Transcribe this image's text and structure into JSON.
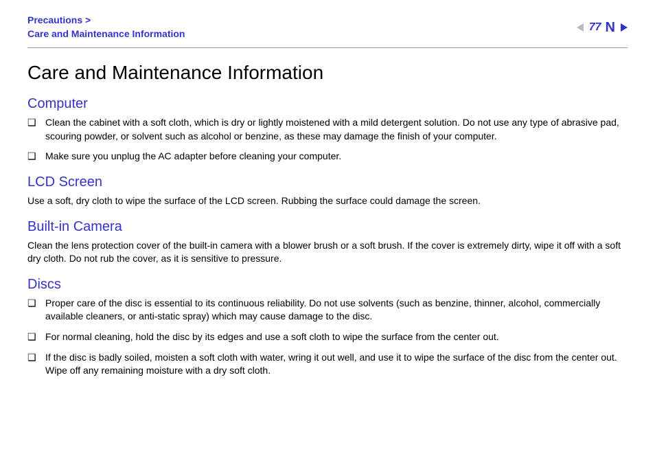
{
  "header": {
    "breadcrumb_parent": "Precautions >",
    "breadcrumb_current": "Care and Maintenance Information",
    "page_number": "77"
  },
  "title": "Care and Maintenance Information",
  "sections": {
    "computer": {
      "heading": "Computer",
      "items": [
        "Clean the cabinet with a soft cloth, which is dry or lightly moistened with a mild detergent solution. Do not use any type of abrasive pad, scouring powder, or solvent such as alcohol or benzine, as these may damage the finish of your computer.",
        "Make sure you unplug the AC adapter before cleaning your computer."
      ]
    },
    "lcd": {
      "heading": "LCD Screen",
      "text": "Use a soft, dry cloth to wipe the surface of the LCD screen. Rubbing the surface could damage the screen."
    },
    "camera": {
      "heading": "Built-in Camera",
      "text": "Clean the lens protection cover of the built-in camera with a blower brush or a soft brush. If the cover is extremely dirty, wipe it off with a soft dry cloth. Do not rub the cover, as it is sensitive to pressure."
    },
    "discs": {
      "heading": "Discs",
      "items": [
        "Proper care of the disc is essential to its continuous reliability. Do not use solvents (such as benzine, thinner, alcohol, commercially available cleaners, or anti-static spray) which may cause damage to the disc.",
        "For normal cleaning, hold the disc by its edges and use a soft cloth to wipe the surface from the center out.",
        "If the disc is badly soiled, moisten a soft cloth with water, wring it out well, and use it to wipe the surface of the disc from the center out. Wipe off any remaining moisture with a dry soft cloth."
      ]
    }
  }
}
